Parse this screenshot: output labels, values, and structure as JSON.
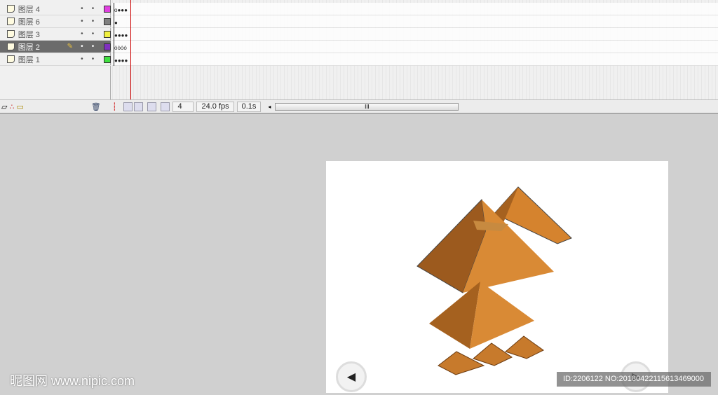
{
  "layers": [
    {
      "name": "图层 4",
      "color": "#e040e0",
      "frames": "o●●●"
    },
    {
      "name": "图层 6",
      "color": "#808080",
      "frames": "●"
    },
    {
      "name": "图层 3",
      "color": "#f0f040",
      "frames": "●●●●"
    },
    {
      "name": "图层 2",
      "color": "#8030c0",
      "frames": "ȯȯȯȯ",
      "selected": true
    },
    {
      "name": "图层 1",
      "color": "#40e040",
      "frames": "●●●●"
    }
  ],
  "layer_dot": "•",
  "status": {
    "frame": "4",
    "fps": "24.0 fps",
    "time": "0.1s",
    "scroll_grip": "III"
  },
  "watermark": "昵图网 www.nipic.com",
  "image_id": "ID:2206122 NO:20180422115613469000",
  "nav": {
    "prev": "◀",
    "next": "▶"
  }
}
